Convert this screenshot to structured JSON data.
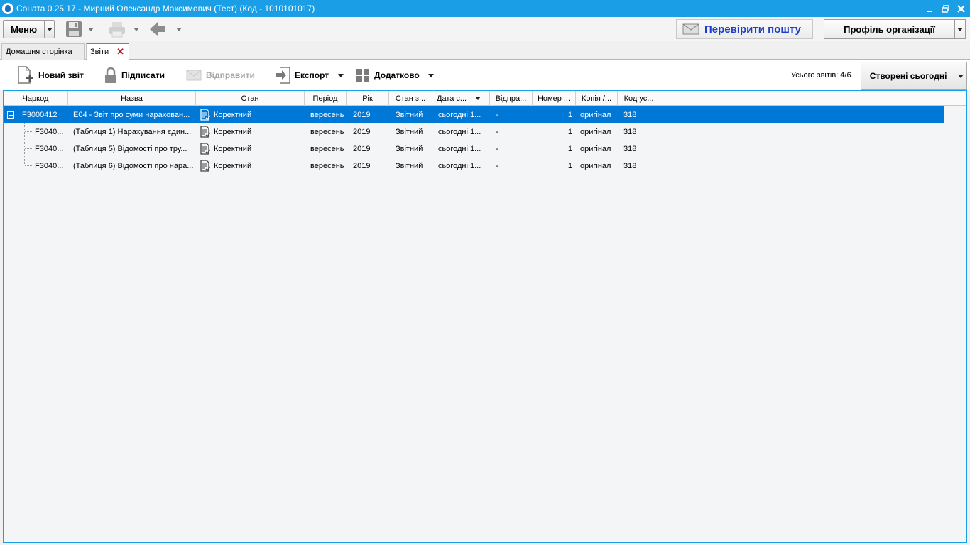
{
  "window": {
    "title": "Соната 0.25.17 - Мирний Олександр Максимович (Тест) (Код - 1010101017)"
  },
  "toolbar": {
    "menu_label": "Меню",
    "check_mail_label": "Перевірити пошту",
    "profile_label": "Профіль організації"
  },
  "tabs": [
    {
      "label": "Домашня сторінка"
    },
    {
      "label": "Звіти"
    }
  ],
  "reports_toolbar": {
    "new_report": "Новий звіт",
    "sign": "Підписати",
    "send": "Відправити",
    "export": "Експорт",
    "more": "Додатково",
    "total": "Усього звітів: 4/6",
    "filter": "Створені сьогодні"
  },
  "grid": {
    "columns": [
      "Чаркод",
      "Назва",
      "Стан",
      "Період",
      "Рік",
      "Стан з...",
      "Дата с...",
      "Відпра...",
      "Номер ...",
      "Копія /...",
      "Код ус..."
    ],
    "rows": [
      {
        "code": "F3000412",
        "name": "E04 - Звіт про суми нарахован...",
        "state": "Коректний",
        "period": "вересень",
        "year": "2019",
        "state_z": "Звітний",
        "date": "сьогодні 1...",
        "sent": "-",
        "number": "1",
        "copy": "оригінал",
        "kod": "318"
      },
      {
        "code": "F3040...",
        "name": "(Таблиця 1) Нарахування єдин...",
        "state": "Коректний",
        "period": "вересень",
        "year": "2019",
        "state_z": "Звітний",
        "date": "сьогодні 1...",
        "sent": "-",
        "number": "1",
        "copy": "оригінал",
        "kod": "318"
      },
      {
        "code": "F3040...",
        "name": "(Таблиця 5) Відомості про тру...",
        "state": "Коректний",
        "period": "вересень",
        "year": "2019",
        "state_z": "Звітний",
        "date": "сьогодні 1...",
        "sent": "-",
        "number": "1",
        "copy": "оригінал",
        "kod": "318"
      },
      {
        "code": "F3040...",
        "name": "(Таблиця 6) Відомості про нара...",
        "state": "Коректний",
        "period": "вересень",
        "year": "2019",
        "state_z": "Звітний",
        "date": "сьогодні 1...",
        "sent": "-",
        "number": "1",
        "copy": "оригінал",
        "kod": "318"
      }
    ]
  },
  "colors": {
    "titlebar": "#1a9ee6",
    "selection": "#0078d7",
    "mail_label": "#1b3ec9",
    "tab_close": "#c0141c"
  }
}
